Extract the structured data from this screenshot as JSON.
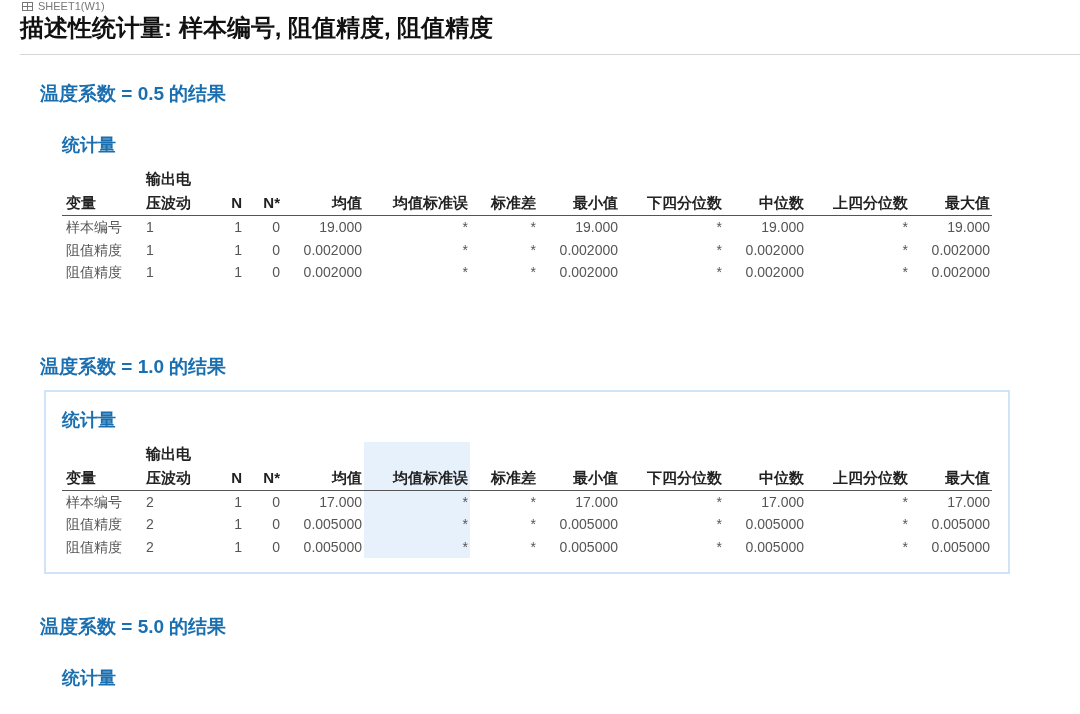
{
  "sheet_label": "SHEET1(W1)",
  "title": "描述性统计量: 样本编号, 阻值精度, 阻值精度",
  "sections": [
    {
      "title": "温度系数 = 0.5 的结果",
      "subtitle": "统计量",
      "selected": false,
      "columns": [
        {
          "label": "变量",
          "highlighted": false
        },
        {
          "label": "输出电压波动",
          "highlighted": false
        },
        {
          "label": "N",
          "highlighted": false
        },
        {
          "label": "N*",
          "highlighted": false
        },
        {
          "label": "均值",
          "highlighted": false
        },
        {
          "label": "均值标准误",
          "highlighted": false
        },
        {
          "label": "标准差",
          "highlighted": false
        },
        {
          "label": "最小值",
          "highlighted": false
        },
        {
          "label": "下四分位数",
          "highlighted": false
        },
        {
          "label": "中位数",
          "highlighted": false
        },
        {
          "label": "上四分位数",
          "highlighted": false
        },
        {
          "label": "最大值",
          "highlighted": false
        }
      ],
      "rows": [
        [
          "样本编号",
          "1",
          "1",
          "0",
          "19.000",
          "*",
          "*",
          "19.000",
          "*",
          "19.000",
          "*",
          "19.000"
        ],
        [
          "阻值精度",
          "1",
          "1",
          "0",
          "0.002000",
          "*",
          "*",
          "0.002000",
          "*",
          "0.002000",
          "*",
          "0.002000"
        ],
        [
          "阻值精度",
          "1",
          "1",
          "0",
          "0.002000",
          "*",
          "*",
          "0.002000",
          "*",
          "0.002000",
          "*",
          "0.002000"
        ]
      ]
    },
    {
      "title": "温度系数 = 1.0 的结果",
      "subtitle": "统计量",
      "selected": true,
      "columns": [
        {
          "label": "变量",
          "highlighted": false
        },
        {
          "label": "输出电压波动",
          "highlighted": false
        },
        {
          "label": "N",
          "highlighted": false
        },
        {
          "label": "N*",
          "highlighted": false
        },
        {
          "label": "均值",
          "highlighted": false
        },
        {
          "label": "均值标准误",
          "highlighted": true
        },
        {
          "label": "标准差",
          "highlighted": false
        },
        {
          "label": "最小值",
          "highlighted": false
        },
        {
          "label": "下四分位数",
          "highlighted": false
        },
        {
          "label": "中位数",
          "highlighted": false
        },
        {
          "label": "上四分位数",
          "highlighted": false
        },
        {
          "label": "最大值",
          "highlighted": false
        }
      ],
      "rows": [
        [
          "样本编号",
          "2",
          "1",
          "0",
          "17.000",
          "*",
          "*",
          "17.000",
          "*",
          "17.000",
          "*",
          "17.000"
        ],
        [
          "阻值精度",
          "2",
          "1",
          "0",
          "0.005000",
          "*",
          "*",
          "0.005000",
          "*",
          "0.005000",
          "*",
          "0.005000"
        ],
        [
          "阻值精度",
          "2",
          "1",
          "0",
          "0.005000",
          "*",
          "*",
          "0.005000",
          "*",
          "0.005000",
          "*",
          "0.005000"
        ]
      ]
    },
    {
      "title": "温度系数 = 5.0 的结果",
      "subtitle": "统计量",
      "selected": false
    }
  ]
}
